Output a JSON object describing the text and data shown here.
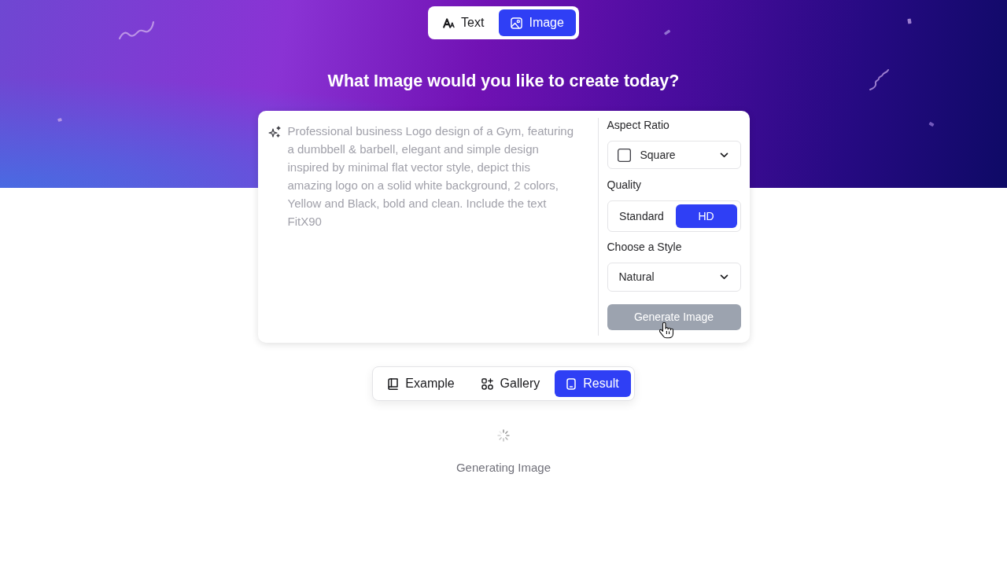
{
  "mode_tabs": [
    {
      "label": "Text",
      "selected": false
    },
    {
      "label": "Image",
      "selected": true
    }
  ],
  "heading": "What Image would you like to create today?",
  "prompt": {
    "placeholder": "Professional business Logo design of a Gym, featuring a dumbbell & barbell, elegant and simple design inspired by minimal flat vector style, depict this amazing logo on a solid white background, 2 colors, Yellow and Black, bold and clean. Include the text FitX90"
  },
  "settings": {
    "aspect_ratio": {
      "label": "Aspect Ratio",
      "value": "Square"
    },
    "quality": {
      "label": "Quality",
      "options": [
        {
          "label": "Standard",
          "selected": false
        },
        {
          "label": "HD",
          "selected": true
        }
      ]
    },
    "style": {
      "label": "Choose a Style",
      "value": "Natural"
    },
    "generate_button": {
      "label": "Generate Image",
      "disabled": true
    }
  },
  "result_tabs": [
    {
      "label": "Example",
      "selected": false
    },
    {
      "label": "Gallery",
      "selected": false
    },
    {
      "label": "Result",
      "selected": true
    }
  ],
  "status": {
    "text": "Generating Image",
    "loading": true
  }
}
